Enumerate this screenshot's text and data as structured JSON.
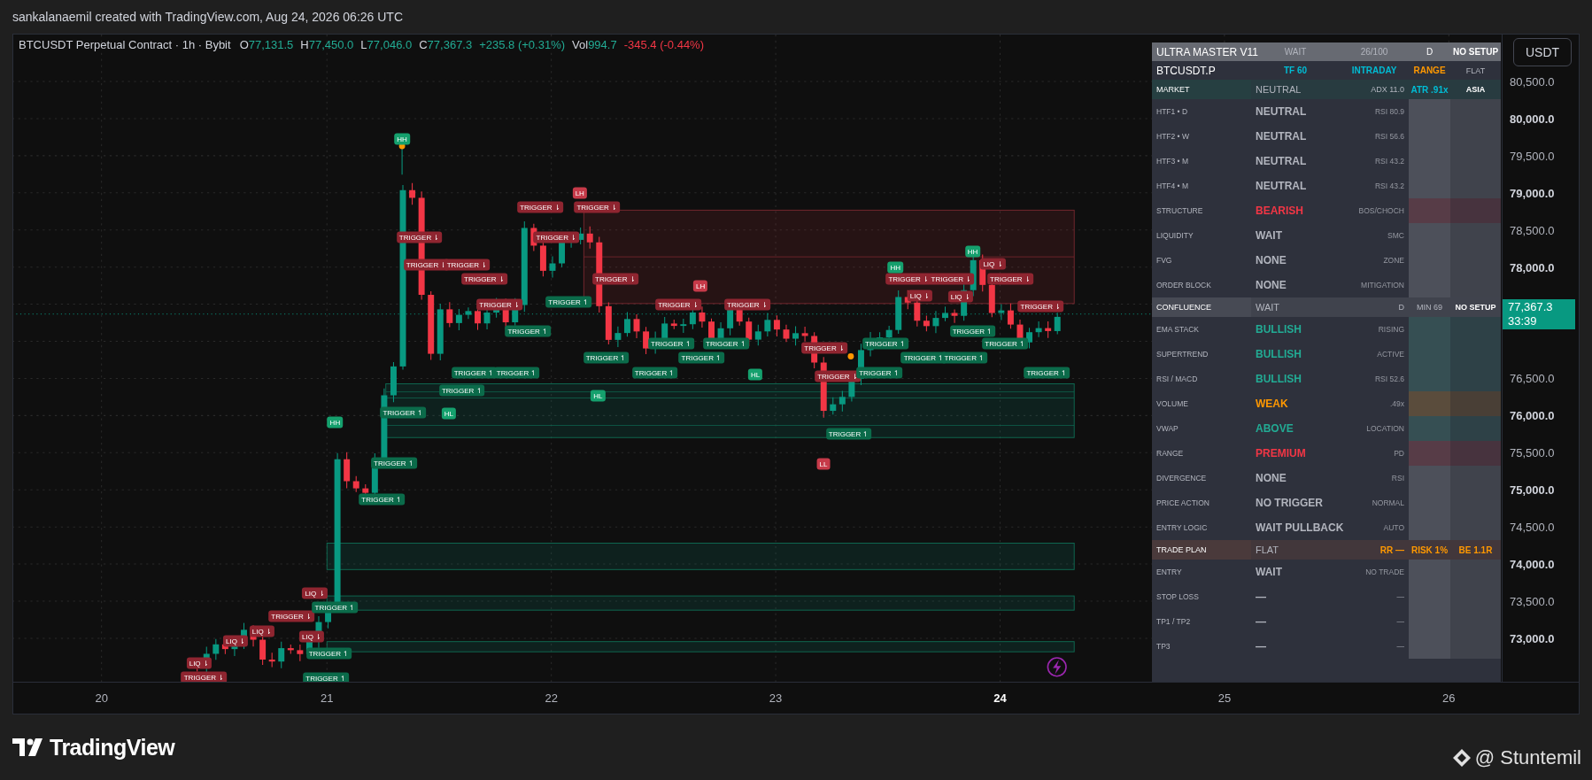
{
  "caption": "sankalanaemil created with TradingView.com, Aug 24, 2026 06:26 UTC",
  "legend": {
    "symbol": "BTCUSDT Perpetual Contract · 1h · Bybit",
    "fields": [
      {
        "label": "O",
        "value": "77,131.5",
        "color": "#22ab94"
      },
      {
        "label": "H",
        "value": "77,450.0",
        "color": "#22ab94"
      },
      {
        "label": "L",
        "value": "77,046.0",
        "color": "#22ab94"
      },
      {
        "label": "C",
        "value": "77,367.3",
        "color": "#22ab94"
      },
      {
        "value": "+235.8 (+0.31%)",
        "color": "#22ab94"
      },
      {
        "label": "Vol",
        "value": "994.7",
        "color": "#22ab94"
      },
      {
        "value": "-345.4 (-0.44%)",
        "color": "#f23645"
      }
    ]
  },
  "markers": [
    {
      "label": "TRIGGER ⇂",
      "kind": "bear"
    },
    {
      "label": "TRIGGER ⇂",
      "kind": "bear"
    },
    {
      "label": "TRIGGER ⇂",
      "kind": "bear"
    },
    {
      "label": "TRIGGER ⇂",
      "kind": "bear"
    },
    {
      "label": "TRIGGER ⇂",
      "kind": "bear"
    },
    {
      "label": "TRIGGER ⇂",
      "kind": "bear"
    },
    {
      "label": "TRIGGER ⇂",
      "kind": "bear"
    },
    {
      "label": "TRIGGER ⇂",
      "kind": "bear"
    },
    {
      "label": "TRIGGER ⇂",
      "kind": "bear"
    },
    {
      "label": "TRIGGER ⇂",
      "kind": "bear"
    },
    {
      "label": "TRIGGER ⇂",
      "kind": "bear"
    },
    {
      "label": "TRIGGER ⇂",
      "kind": "bear"
    },
    {
      "label": "TRIGGER ⇂",
      "kind": "bear"
    },
    {
      "label": "TRIGGER ⇂",
      "kind": "bear"
    },
    {
      "label": "TRIGGER ⇂",
      "kind": "bear"
    },
    {
      "label": "TRIGGER ⇂",
      "kind": "bear"
    },
    {
      "label": "TRIGGER ⇂",
      "kind": "bear"
    },
    {
      "label": "LIQ ⇂",
      "kind": "bear"
    },
    {
      "label": "LIQ ⇂",
      "kind": "bear"
    },
    {
      "label": "LIQ ⇂",
      "kind": "bear"
    },
    {
      "label": "LH",
      "kind": "pivot_bear"
    },
    {
      "label": "LH",
      "kind": "pivot_bear"
    },
    {
      "label": "LL",
      "kind": "pivot_bear"
    },
    {
      "label": "LIQ ⇂",
      "kind": "bear"
    },
    {
      "label": "TRIGGER ⇂",
      "kind": "bear"
    },
    {
      "label": "LIQ ⇂",
      "kind": "bear"
    },
    {
      "label": "LIQ ⇂",
      "kind": "bear"
    },
    {
      "label": "TRIGGER ⇂",
      "kind": "bear"
    },
    {
      "label": "LIQ ⇂",
      "kind": "bear"
    },
    {
      "label": "LIQ ⇂",
      "kind": "bear"
    },
    {
      "label": "TRIGGER ↿",
      "kind": "bull"
    },
    {
      "label": "TRIGGER ↿",
      "kind": "bull"
    },
    {
      "label": "TRIGGER ↿",
      "kind": "bull"
    },
    {
      "label": "TRIGGER ↿",
      "kind": "bull"
    },
    {
      "label": "TRIGGER ↿",
      "kind": "bull"
    },
    {
      "label": "TRIGGER ↿",
      "kind": "bull"
    },
    {
      "label": "TRIGGER ↿",
      "kind": "bull"
    },
    {
      "label": "TRIGGER ↿",
      "kind": "bull"
    },
    {
      "label": "TRIGGER ↿",
      "kind": "bull"
    },
    {
      "label": "TRIGGER ↿",
      "kind": "bull"
    },
    {
      "label": "TRIGGER ↿",
      "kind": "bull"
    },
    {
      "label": "TRIGGER ↿",
      "kind": "bull"
    },
    {
      "label": "TRIGGER ↿",
      "kind": "bull"
    },
    {
      "label": "TRIGGER ↿",
      "kind": "bull"
    },
    {
      "label": "TRIGGER ↿",
      "kind": "bull"
    },
    {
      "label": "TRIGGER ↿",
      "kind": "bull"
    },
    {
      "label": "TRIGGER ↿",
      "kind": "bull"
    },
    {
      "label": "TRIGGER ↿",
      "kind": "bull"
    },
    {
      "label": "TRIGGER ↿",
      "kind": "bull"
    },
    {
      "label": "TRIGGER ↿",
      "kind": "bull"
    },
    {
      "label": "TRIGGER ↿",
      "kind": "bull"
    },
    {
      "label": "TRIGGER ↿",
      "kind": "bull"
    },
    {
      "label": "TRIGGER ↿",
      "kind": "bull"
    },
    {
      "label": "TRIGGER ↿",
      "kind": "bull"
    },
    {
      "label": "HH",
      "kind": "pivot_bull"
    },
    {
      "label": "HH",
      "kind": "pivot_bull"
    },
    {
      "label": "HH",
      "kind": "pivot_bull"
    },
    {
      "label": "HH",
      "kind": "pivot_bull"
    },
    {
      "label": "HL",
      "kind": "pivot_bull"
    },
    {
      "label": "HL",
      "kind": "pivot_bull"
    },
    {
      "label": "HL",
      "kind": "pivot_bull"
    }
  ],
  "table": {
    "rows": [
      {
        "kind": "title",
        "cells": [
          {
            "text": "ULTRA MASTER V11"
          },
          {
            "text": "WAIT"
          },
          {
            "text": "26/100"
          },
          {
            "text": "D"
          },
          {
            "text": "NO SETUP"
          }
        ]
      },
      {
        "kind": "symbol",
        "cells": [
          {
            "text": "BTCUSDT.P"
          },
          {
            "text": "TF 60",
            "color": "#00bcd4"
          },
          {
            "text": "INTRADAY",
            "color": "#00bcd4"
          },
          {
            "text": "RANGE",
            "color": "#ff9800"
          },
          {
            "text": "FLAT"
          }
        ]
      },
      {
        "kind": "section",
        "color": "#263f41",
        "cells": [
          {
            "text": "MARKET"
          },
          {
            "text": "NEUTRAL"
          },
          {
            "text": "ADX 11.0"
          },
          {
            "text": "ATR .91x",
            "color": "#00bcd4"
          },
          {
            "text": "ASIA"
          }
        ]
      },
      {
        "kind": "data",
        "color": "#b2b5be",
        "label": "HTF1 • D",
        "value": "NEUTRAL",
        "note": "RSI 80.9"
      },
      {
        "kind": "data",
        "color": "#b2b5be",
        "label": "HTF2 • W",
        "value": "NEUTRAL",
        "note": "RSI 56.6"
      },
      {
        "kind": "data",
        "color": "#b2b5be",
        "label": "HTF3 • M",
        "value": "NEUTRAL",
        "note": "RSI 43.2"
      },
      {
        "kind": "data",
        "color": "#b2b5be",
        "label": "HTF4 • M",
        "value": "NEUTRAL",
        "note": "RSI 43.2"
      },
      {
        "kind": "data",
        "color": "#f23645",
        "label": "STRUCTURE",
        "value": "BEARISH",
        "note": "BOS/CHOCH"
      },
      {
        "kind": "data",
        "color": "#b2b5be",
        "label": "LIQUIDITY",
        "value": "WAIT",
        "note": "SMC"
      },
      {
        "kind": "data",
        "color": "#b2b5be",
        "label": "FVG",
        "value": "NONE",
        "note": "ZONE"
      },
      {
        "kind": "data",
        "color": "#b2b5be",
        "label": "ORDER BLOCK",
        "value": "NONE",
        "note": "MITIGATION"
      },
      {
        "kind": "section",
        "color": "#474a54",
        "cells": [
          {
            "text": "CONFLUENCE"
          },
          {
            "text": "WAIT"
          },
          {
            "text": "D"
          },
          {
            "text": "MIN 69"
          },
          {
            "text": "NO SETUP"
          }
        ]
      },
      {
        "kind": "data",
        "color": "#22ab94",
        "label": "EMA STACK",
        "value": "BULLISH",
        "note": "RISING"
      },
      {
        "kind": "data",
        "color": "#22ab94",
        "label": "SUPERTREND",
        "value": "BULLISH",
        "note": "ACTIVE"
      },
      {
        "kind": "data",
        "color": "#22ab94",
        "label": "RSI / MACD",
        "value": "BULLISH",
        "note": "RSI 52.6"
      },
      {
        "kind": "data",
        "color": "#ff9800",
        "label": "VOLUME",
        "value": "WEAK",
        "note": ".49x"
      },
      {
        "kind": "data",
        "color": "#22ab94",
        "label": "VWAP",
        "value": "ABOVE",
        "note": "LOCATION"
      },
      {
        "kind": "data",
        "color": "#f23645",
        "label": "RANGE",
        "value": "PREMIUM",
        "note": "PD"
      },
      {
        "kind": "data",
        "color": "#b2b5be",
        "label": "DIVERGENCE",
        "value": "NONE",
        "note": "RSI"
      },
      {
        "kind": "data",
        "color": "#b2b5be",
        "label": "PRICE ACTION",
        "value": "NO TRIGGER",
        "note": "NORMAL"
      },
      {
        "kind": "data",
        "color": "#b2b5be",
        "label": "ENTRY LOGIC",
        "value": "WAIT PULLBACK",
        "note": "AUTO"
      },
      {
        "kind": "section",
        "color": "#4a3a3b",
        "cells": [
          {
            "text": "TRADE PLAN"
          },
          {
            "text": "FLAT"
          },
          {
            "text": "RR —",
            "color": "#ff9800"
          },
          {
            "text": "RISK 1%",
            "color": "#ff9800"
          },
          {
            "text": "BE 1.1R",
            "color": "#ff9800"
          }
        ]
      },
      {
        "kind": "data",
        "color": "#b2b5be",
        "label": "ENTRY",
        "value": "WAIT",
        "note": "NO TRADE"
      },
      {
        "kind": "data",
        "color": "#b2b5be",
        "label": "STOP LOSS",
        "value": "—",
        "note": "—"
      },
      {
        "kind": "data",
        "color": "#b2b5be",
        "label": "TP1 / TP2",
        "value": "—",
        "note": "—"
      },
      {
        "kind": "data",
        "color": "#b2b5be",
        "label": "TP3",
        "value": "—",
        "note": "—"
      }
    ]
  },
  "price_axis": {
    "unit_button": "USDT",
    "ticks": [
      {
        "label": "80,500.0",
        "major": false
      },
      {
        "label": "80,000.0",
        "major": true
      },
      {
        "label": "79,500.0",
        "major": false
      },
      {
        "label": "79,000.0",
        "major": true
      },
      {
        "label": "78,500.0",
        "major": false
      },
      {
        "label": "78,000.0",
        "major": true
      },
      {
        "label": "76,500.0",
        "major": false
      },
      {
        "label": "76,000.0",
        "major": true
      },
      {
        "label": "75,500.0",
        "major": false
      },
      {
        "label": "75,000.0",
        "major": true
      },
      {
        "label": "74,500.0",
        "major": false
      },
      {
        "label": "74,000.0",
        "major": true
      },
      {
        "label": "73,500.0",
        "major": false
      },
      {
        "label": "73,000.0",
        "major": true
      }
    ],
    "last_price": {
      "price": "77,367.3",
      "countdown": "33:39"
    }
  },
  "time_axis": [
    {
      "label": "20",
      "current": false
    },
    {
      "label": "21",
      "current": false
    },
    {
      "label": "22",
      "current": false
    },
    {
      "label": "23",
      "current": false
    },
    {
      "label": "24",
      "current": true
    },
    {
      "label": "25",
      "current": false
    },
    {
      "label": "26",
      "current": false
    }
  ],
  "footer": {
    "logo": "TradingView",
    "credit": "@ Stuntemil"
  }
}
